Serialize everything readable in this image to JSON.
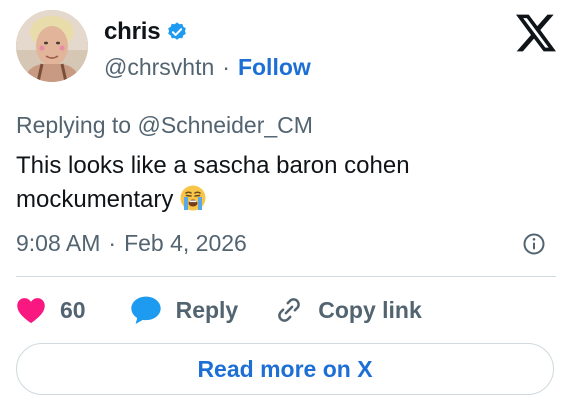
{
  "author": {
    "name": "chris",
    "handle": "@chrsvhtn",
    "follow_label": "Follow",
    "separator": "·",
    "verified_icon": "verified-badge-icon",
    "avatar_icon": "avatar"
  },
  "tweet": {
    "replying_prefix": "Replying to",
    "replying_to": "@Schneider_CM",
    "text": "This looks like a sascha baron cohen mockumentary",
    "emoji": "loudly-crying-face-icon",
    "time": "9:08 AM",
    "date": "Feb 4, 2026",
    "separator": "·"
  },
  "actions": {
    "like_count": "60",
    "reply_label": "Reply",
    "copy_label": "Copy link"
  },
  "footer": {
    "read_more_label": "Read more on X"
  },
  "colors": {
    "link_blue": "#1d6fd6",
    "heart_pink": "#f91880",
    "muted_gray": "#536471",
    "reply_bubble": "#1d9bf0"
  }
}
